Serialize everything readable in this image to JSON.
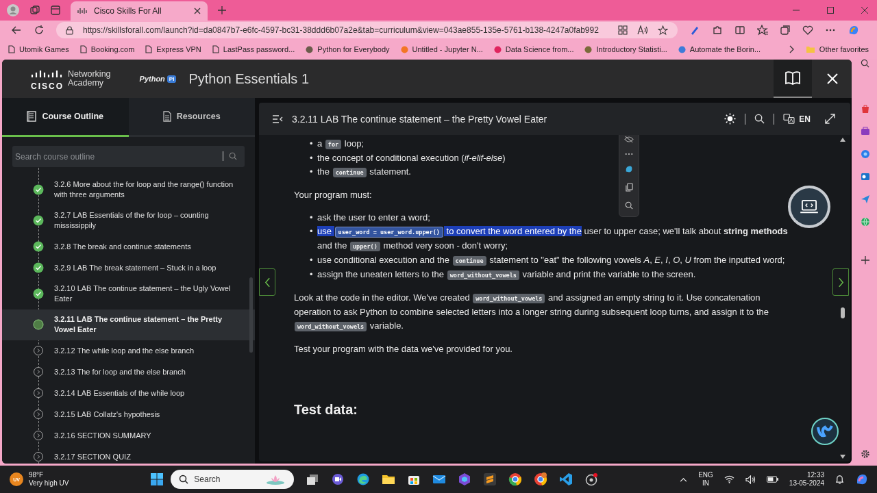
{
  "browser": {
    "tab": {
      "title": "Cisco Skills For All"
    },
    "url": "https://skillsforall.com/launch?id=da0847b7-e6fc-4597-bc31-38ddd6b07a2e&tab=curriculum&view=043ae855-135e-5761-b138-4247a0fab992",
    "bookmarks": [
      {
        "label": "Utomik Games",
        "kind": "page"
      },
      {
        "label": "Booking.com",
        "kind": "page"
      },
      {
        "label": "Express VPN",
        "kind": "page"
      },
      {
        "label": "LastPass password...",
        "kind": "page"
      },
      {
        "label": "Python for Everybody",
        "kind": "site",
        "color": "#6b5b4b"
      },
      {
        "label": "Untitled - Jupyter N...",
        "kind": "site",
        "color": "#f37626"
      },
      {
        "label": "Data Science from...",
        "kind": "site",
        "color": "#e0245e"
      },
      {
        "label": "Introductory Statisti...",
        "kind": "site",
        "color": "#7a6a3a"
      },
      {
        "label": "Automate the Borin...",
        "kind": "site",
        "color": "#3d7bd9"
      }
    ],
    "other_favorites": "Other favorites"
  },
  "app": {
    "logo": {
      "wordmark": "CISCO",
      "line_1": "Networking",
      "line_2": "Academy"
    },
    "partner_logo": {
      "name": "Python",
      "badge": "PI"
    },
    "title": "Python Essentials 1"
  },
  "sidebar": {
    "tabs": [
      {
        "label": "Course Outline",
        "selected": true
      },
      {
        "label": "Resources",
        "selected": false
      }
    ],
    "search": {
      "placeholder": "Search course outline"
    },
    "items": [
      {
        "label": "3.2.6 More about the for loop and the range() function with three arguments",
        "completed": true,
        "selected": false
      },
      {
        "label": "3.2.7 LAB Essentials of the for loop – counting mississippily",
        "completed": true,
        "selected": false
      },
      {
        "label": "3.2.8 The break and continue statements",
        "completed": true,
        "selected": false
      },
      {
        "label": "3.2.9 LAB The break statement – Stuck in a loop",
        "completed": true,
        "selected": false
      },
      {
        "label": "3.2.10 LAB The continue statement – the Ugly Vowel Eater",
        "completed": true,
        "selected": false
      },
      {
        "label": "3.2.11 LAB The continue statement – the Pretty Vowel Eater",
        "completed": false,
        "selected": true
      },
      {
        "label": "3.2.12 The while loop and the else branch",
        "completed": false,
        "selected": false
      },
      {
        "label": "3.2.13 The for loop and the else branch",
        "completed": false,
        "selected": false
      },
      {
        "label": "3.2.14 LAB Essentials of the while loop",
        "completed": false,
        "selected": false
      },
      {
        "label": "3.2.15 LAB Collatz's hypothesis",
        "completed": false,
        "selected": false
      },
      {
        "label": "3.2.16 SECTION SUMMARY",
        "completed": false,
        "selected": false
      },
      {
        "label": "3.2.17 SECTION QUIZ",
        "completed": false,
        "selected": false
      }
    ]
  },
  "lesson": {
    "title": "3.2.11 LAB The continue statement – the Pretty Vowel Eater",
    "language": "EN",
    "blocks": [
      {
        "kind": "bullets",
        "marker": "•",
        "items": [
          [
            {
              "kind": "text",
              "text": "a ",
              "selected": false
            },
            {
              "kind": "code",
              "text": "for",
              "selected": false
            },
            {
              "kind": "text",
              "text": " loop;",
              "selected": false
            }
          ],
          [
            {
              "kind": "text",
              "text": "the concept of conditional execution (*if-elif-else*)",
              "selected": false
            }
          ],
          [
            {
              "kind": "text",
              "text": "the ",
              "selected": false
            },
            {
              "kind": "code",
              "text": "continue",
              "selected": false
            },
            {
              "kind": "text",
              "text": " statement.",
              "selected": false
            }
          ]
        ]
      },
      {
        "kind": "paragraph",
        "segments": [
          {
            "kind": "text",
            "text": "Your program must:",
            "selected": false
          }
        ]
      },
      {
        "kind": "bullets",
        "marker": "•",
        "items": [
          [
            {
              "kind": "text",
              "text": "ask the user to enter a word;",
              "selected": false
            }
          ],
          [
            {
              "kind": "text",
              "text": "use ",
              "selected": true
            },
            {
              "kind": "code",
              "text": "user_word = user_word.upper()",
              "selected": true
            },
            {
              "kind": "text",
              "text": " to convert the word entered by the",
              "selected": true
            },
            {
              "kind": "text",
              "text": " user to upper case; we'll talk about **string methods** and the ",
              "selected": false
            },
            {
              "kind": "code",
              "text": "upper()",
              "selected": false
            },
            {
              "kind": "text",
              "text": " method very soon - don't worry;",
              "selected": false
            }
          ],
          [
            {
              "kind": "text",
              "text": "use conditional execution and the ",
              "selected": false
            },
            {
              "kind": "code",
              "text": "continue",
              "selected": false
            },
            {
              "kind": "text",
              "text": " statement to \"eat\" the following vowels *A*, *E*, *I*, *O*, *U* from the inputted word;",
              "selected": false
            }
          ],
          [
            {
              "kind": "text",
              "text": "assign the uneaten letters to the ",
              "selected": false
            },
            {
              "kind": "code",
              "text": "word_without_vowels",
              "selected": false
            },
            {
              "kind": "text",
              "text": " variable and print the variable to the screen.",
              "selected": false
            }
          ]
        ]
      },
      {
        "kind": "paragraph",
        "segments": [
          {
            "kind": "text",
            "text": "Look at the code in the editor. We've created ",
            "selected": false
          },
          {
            "kind": "code",
            "text": "word_without_vowels",
            "selected": false
          },
          {
            "kind": "text",
            "text": " and assigned an empty string to it. Use concatenation operation to ask Python to combine selected letters into a longer string during subsequent loop turns, and assign it to the ",
            "selected": false
          },
          {
            "kind": "code",
            "text": "word_without_vowels",
            "selected": false
          },
          {
            "kind": "text",
            "text": " variable.",
            "selected": false
          }
        ]
      },
      {
        "kind": "paragraph",
        "segments": [
          {
            "kind": "text",
            "text": "Test your program with the data we've provided for you.",
            "selected": false
          }
        ]
      },
      {
        "kind": "heading",
        "text": "Test data:"
      }
    ]
  },
  "taskbar": {
    "weather": {
      "badge": "UV",
      "temperature": "98°F",
      "condition": "Very high UV"
    },
    "search": {
      "placeholder": "Search"
    },
    "language": {
      "line_1": "ENG",
      "line_2": "IN"
    },
    "time": "12:33",
    "date": "13-05-2024"
  }
}
